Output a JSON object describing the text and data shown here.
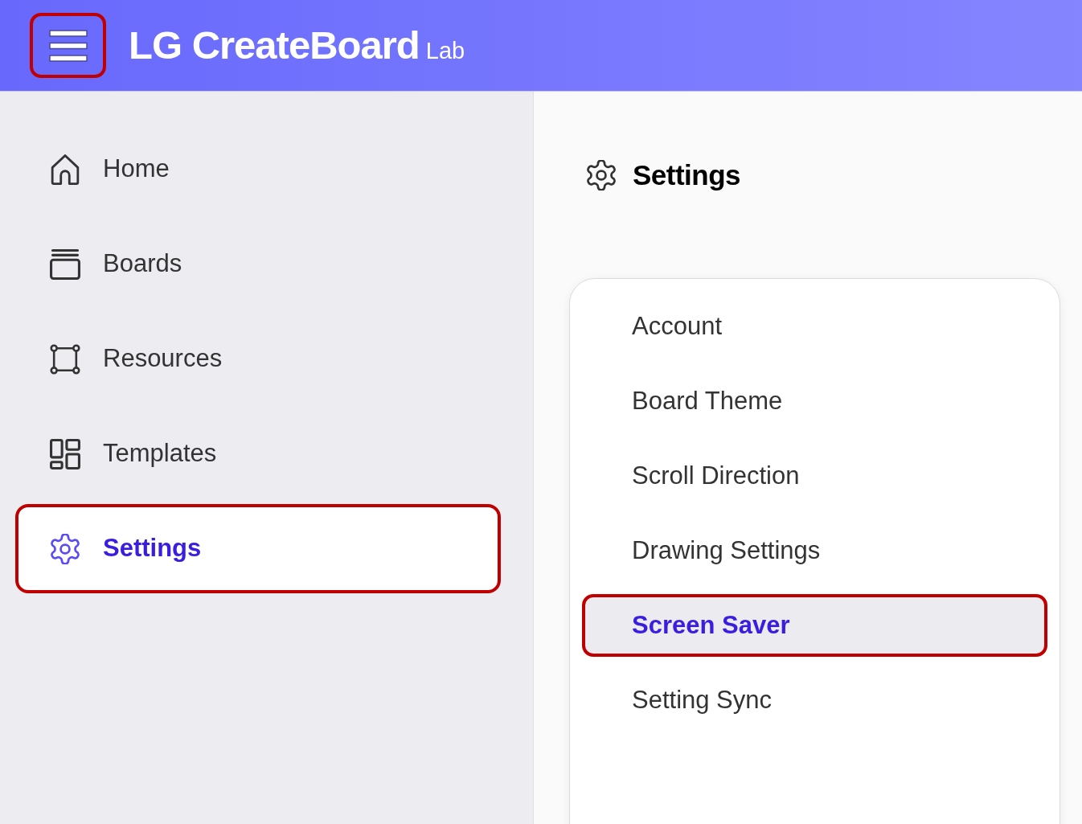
{
  "header": {
    "menu_button": {
      "highlighted": true
    },
    "logo": {
      "brand": "LG CreateBoard",
      "suffix": "Lab"
    }
  },
  "sidebar": {
    "items": [
      {
        "label": "Home",
        "selected": false,
        "highlighted": false
      },
      {
        "label": "Boards",
        "selected": false,
        "highlighted": false
      },
      {
        "label": "Resources",
        "selected": false,
        "highlighted": false
      },
      {
        "label": "Templates",
        "selected": false,
        "highlighted": false
      },
      {
        "label": "Settings",
        "selected": true,
        "highlighted": true
      }
    ]
  },
  "page": {
    "title": "Settings",
    "menu": [
      {
        "label": "Account",
        "selected": false,
        "highlighted": false
      },
      {
        "label": "Board Theme",
        "selected": false,
        "highlighted": false
      },
      {
        "label": "Scroll Direction",
        "selected": false,
        "highlighted": false
      },
      {
        "label": "Drawing Settings",
        "selected": false,
        "highlighted": false
      },
      {
        "label": "Screen Saver",
        "selected": true,
        "highlighted": true
      },
      {
        "label": "Setting Sync",
        "selected": false,
        "highlighted": false
      }
    ]
  }
}
